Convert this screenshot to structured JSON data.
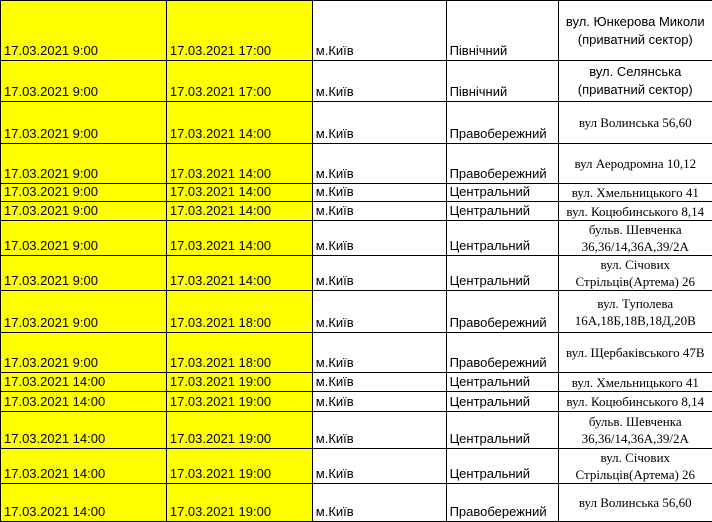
{
  "rows": [
    {
      "start": "17.03.2021 9:00",
      "end": "17.03.2021 17:00",
      "city": "м.Київ",
      "district": "Північний",
      "address": "вул. Юнкерова Миколи (приватний сектор)",
      "serif": false
    },
    {
      "start": "17.03.2021 9:00",
      "end": "17.03.2021 17:00",
      "city": "м.Київ",
      "district": "Північний",
      "address": "вул. Селянська (приватний сектор)",
      "serif": false
    },
    {
      "start": "17.03.2021 9:00",
      "end": "17.03.2021 14:00",
      "city": "м.Київ",
      "district": "Правобережний",
      "address": "вул Волинська 56,60",
      "serif": true
    },
    {
      "start": "17.03.2021 9:00",
      "end": "17.03.2021 14:00",
      "city": "м.Київ",
      "district": "Правобережний",
      "address": "вул Аеродромна 10,12",
      "serif": true
    },
    {
      "start": "17.03.2021 9:00",
      "end": "17.03.2021 14:00",
      "city": "м.Київ",
      "district": "Центральний",
      "address": "вул. Хмельницького 41",
      "serif": true
    },
    {
      "start": "17.03.2021 9:00",
      "end": "17.03.2021 14:00",
      "city": "м.Київ",
      "district": "Центральний",
      "address": "вул. Коцюбинського 8,14",
      "serif": true
    },
    {
      "start": "17.03.2021 9:00",
      "end": "17.03.2021 14:00",
      "city": "м.Київ",
      "district": "Центральний",
      "address": "бульв. Шевченка 36,36/14,36А,39/2А",
      "serif": true
    },
    {
      "start": "17.03.2021 9:00",
      "end": "17.03.2021 14:00",
      "city": "м.Київ",
      "district": "Центральний",
      "address": "вул. Січових Стрільців(Артема) 26",
      "serif": true
    },
    {
      "start": "17.03.2021 9:00",
      "end": "17.03.2021 18:00",
      "city": "м.Київ",
      "district": "Правобережний",
      "address": "вул. Туполева 16А,18Б,18В,18Д,20В",
      "serif": true
    },
    {
      "start": "17.03.2021 9:00",
      "end": "17.03.2021 18:00",
      "city": "м.Київ",
      "district": "Правобережний",
      "address": "вул. Щербаківського 47В",
      "serif": true
    },
    {
      "start": "17.03.2021 14:00",
      "end": "17.03.2021 19:00",
      "city": "м.Київ",
      "district": "Центральний",
      "address": "вул. Хмельницького 41",
      "serif": true
    },
    {
      "start": "17.03.2021 14:00",
      "end": "17.03.2021 19:00",
      "city": "м.Київ",
      "district": "Центральний",
      "address": "вул. Коцюбинського 8,14",
      "serif": true
    },
    {
      "start": "17.03.2021 14:00",
      "end": "17.03.2021 19:00",
      "city": "м.Київ",
      "district": "Центральний",
      "address": "бульв. Шевченка 36,36/14,36А,39/2А",
      "serif": true
    },
    {
      "start": "17.03.2021 14:00",
      "end": "17.03.2021 19:00",
      "city": "м.Київ",
      "district": "Центральний",
      "address": "вул. Січових Стрільців(Артема) 26",
      "serif": true
    },
    {
      "start": "17.03.2021 14:00",
      "end": "17.03.2021 19:00",
      "city": "м.Київ",
      "district": "Правобережний",
      "address": "вул Волинська 56,60",
      "serif": true
    }
  ],
  "colors": {
    "highlight": "#ffff00",
    "grid": "#000000"
  }
}
